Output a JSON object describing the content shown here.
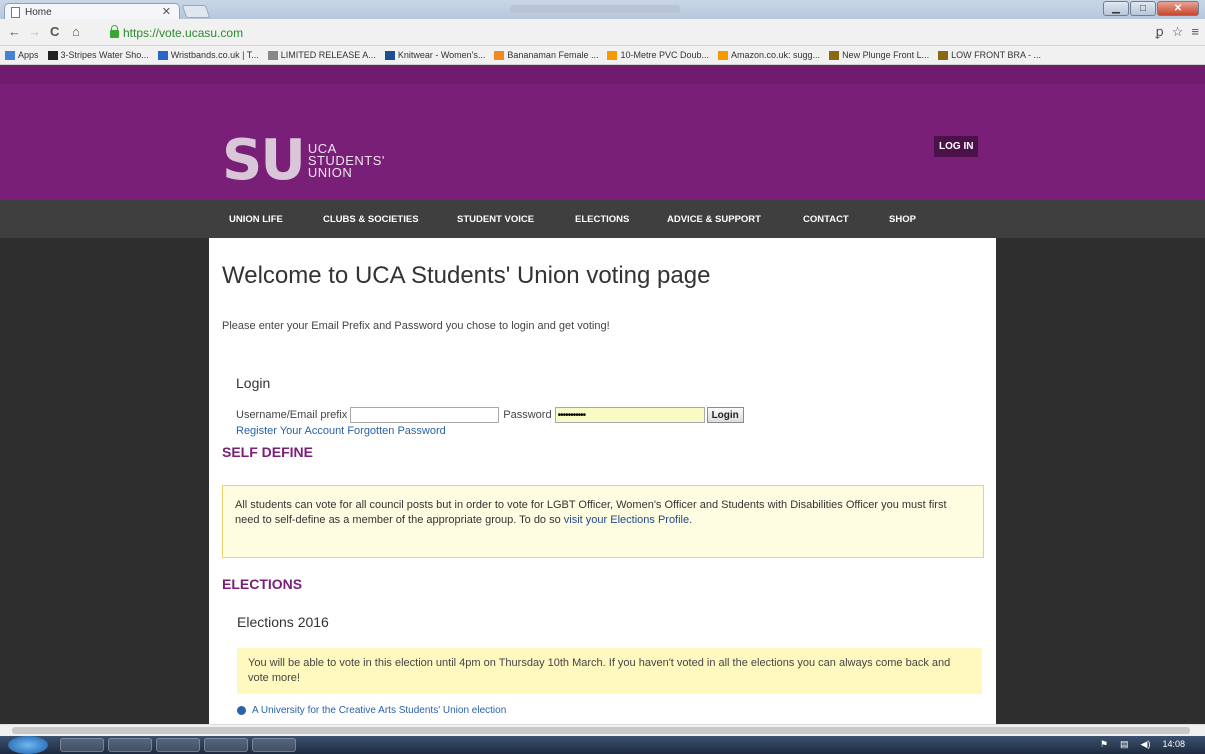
{
  "browser": {
    "tab_title": "Home",
    "url": "https://vote.ucasu.com",
    "bookmarks": [
      {
        "label": "Apps",
        "color": "#4a7fd6"
      },
      {
        "label": "3-Stripes Water Sho...",
        "color": "#222222"
      },
      {
        "label": "Wristbands.co.uk | T...",
        "color": "#2a64c5"
      },
      {
        "label": "LIMITED RELEASE A...",
        "color": "#888888"
      },
      {
        "label": "Knitwear - Women's...",
        "color": "#1c4e91"
      },
      {
        "label": "Bananaman Female ...",
        "color": "#f08a1e"
      },
      {
        "label": "10-Metre PVC Doub...",
        "color": "#f59b00"
      },
      {
        "label": "Amazon.co.uk: sugg...",
        "color": "#f59b00"
      },
      {
        "label": "New Plunge Front L...",
        "color": "#8a6a10"
      },
      {
        "label": "LOW FRONT BRA - ...",
        "color": "#8a6a10"
      }
    ]
  },
  "header": {
    "logo_letters": "SU",
    "logo_line1": "UCA",
    "logo_line2": "STUDENTS'",
    "logo_line3": "UNION",
    "login_label": "LOG IN",
    "brand_color": "#7a1f78"
  },
  "nav": {
    "items": [
      "UNION LIFE",
      "CLUBS & SOCIETIES",
      "STUDENT VOICE",
      "ELECTIONS",
      "ADVICE & SUPPORT",
      "CONTACT",
      "SHOP"
    ]
  },
  "main": {
    "title": "Welcome to UCA Students' Union voting page",
    "intro": "Please enter your Email Prefix and Password you chose to login and get voting!",
    "login": {
      "heading": "Login",
      "username_label": "Username/Email prefix",
      "username_value": "",
      "password_label": "Password",
      "password_value": "•••••••••••",
      "submit_label": "Login",
      "register_link": "Register Your Account",
      "forgot_link": "Forgotten Password"
    },
    "self_define": {
      "heading": "SELF DEFINE",
      "notice": "All students can vote for all council posts but in order to vote for LGBT Officer, Women's Officer and Students with Disabilities Officer you must first need to self-define as a member of the appropriate group. To do so",
      "notice_link": "visit your Elections Profile."
    },
    "elections": {
      "heading": "ELECTIONS",
      "year_heading": "Elections 2016",
      "notice": "You will be able to vote in this election until 4pm on Thursday 10th March. If you haven't voted in all the elections you can always come back and vote more!",
      "election_link": "A University for the Creative Arts Students' Union election"
    }
  },
  "taskbar": {
    "clock": "14:08"
  }
}
